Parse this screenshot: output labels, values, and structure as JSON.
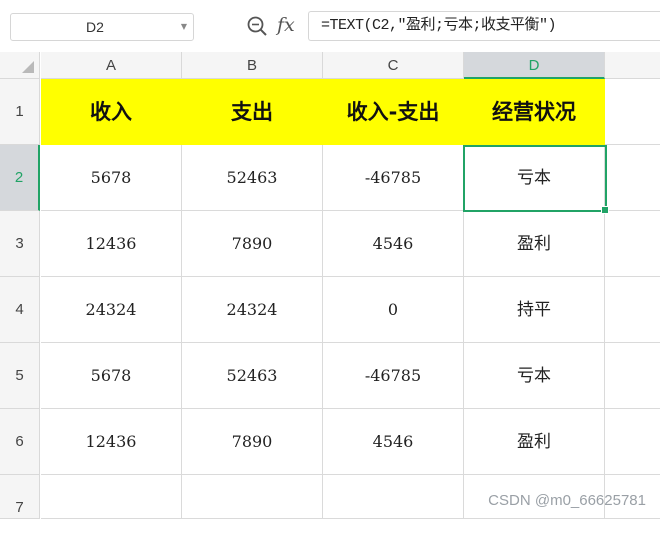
{
  "formula_bar": {
    "name_box": "D2",
    "formula": "=TEXT(C2,\"盈利;亏本;收支平衡\")",
    "zoom_icon": "zoom-search-icon",
    "fx_label": "fx"
  },
  "columns": [
    "A",
    "B",
    "C",
    "D"
  ],
  "active_column": "D",
  "rows": [
    "1",
    "2",
    "3",
    "4",
    "5",
    "6",
    "7"
  ],
  "active_row": "2",
  "header_row": [
    "收入",
    "支出",
    "收入-支出",
    "经营状况"
  ],
  "data_rows": [
    [
      "5678",
      "52463",
      "-46785",
      "亏本"
    ],
    [
      "12436",
      "7890",
      "4546",
      "盈利"
    ],
    [
      "24324",
      "24324",
      "0",
      "持平"
    ],
    [
      "5678",
      "52463",
      "-46785",
      "亏本"
    ],
    [
      "12436",
      "7890",
      "4546",
      "盈利"
    ]
  ],
  "watermark": "CSDN @m0_66625781",
  "colors": {
    "header_fill": "#ffff00",
    "selection": "#21a366",
    "grid": "#dadada"
  }
}
